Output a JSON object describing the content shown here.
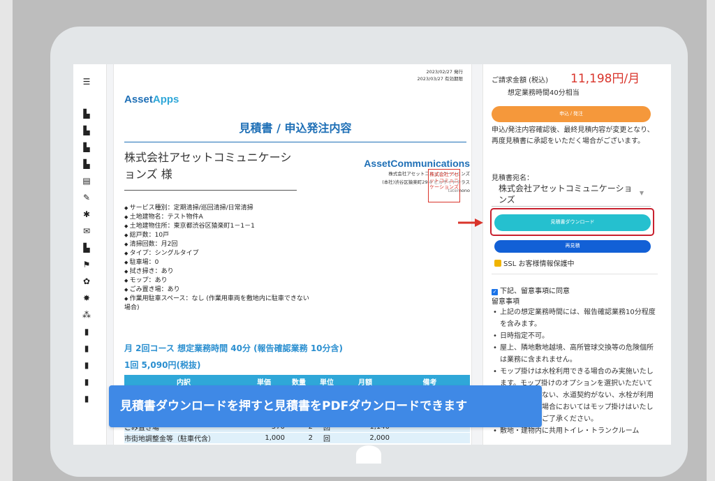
{
  "sidebar": {
    "icons": [
      "menu-icon",
      "building-icon",
      "building-icon",
      "building-icon",
      "building-icon",
      "calendar-icon",
      "wrench-icon",
      "runner-icon",
      "handshake-icon",
      "building-icon",
      "flag-icon",
      "gear-icon",
      "star-icon",
      "users-icon",
      "document-icon",
      "document-icon",
      "document-icon",
      "document-icon",
      "document-icon"
    ]
  },
  "document": {
    "issue_date": "2023/02/27 発行",
    "expiry_date": "2023/03/27 有効期限",
    "logo_a": "Asset",
    "logo_b": "Apps",
    "title": "見積書 / 申込発注内容",
    "client": "株式会社アセットコミュニケーションズ 様",
    "company_name": "AssetCommunications",
    "company_line1": "株式会社アセットコミュニケーションズ",
    "company_line2": "(本社)渋谷区猿楽町29-8 ヒルサイドテラス",
    "company_line3": "tatemono",
    "stamp": "株式会社アセットコミュニケーションズ",
    "items": [
      "サービス種別：定期清掃/巡回清掃/日常清掃",
      "土地建物名：テスト物件A",
      "土地建物住所：東京都渋谷区猿楽町1－1－1",
      "総戸数：10戸",
      "清掃回数：月2回",
      "タイプ：シングルタイプ",
      "駐車場：0",
      "拭き掃き：あり",
      "モップ：あり",
      "ごみ置き場：あり",
      "作業用駐車スペース：なし (作業用車両を敷地内に駐車できない場合)"
    ],
    "course": "月 2回コース 想定業務時間 40分 (報告確認業務 10分含)",
    "price": "1回 5,090円(税抜)",
    "table": {
      "headers": [
        "内訳",
        "単価",
        "数量",
        "単位",
        "月額",
        "備考"
      ],
      "rows": [
        [
          "ごみ置き場",
          "570",
          "2",
          "回",
          "1,140",
          ""
        ],
        [
          "市街地調整金等（駐車代含）",
          "1,000",
          "2",
          "回",
          "2,000",
          ""
        ]
      ]
    }
  },
  "summary": {
    "amount_label": "ご請求金額 (税込)",
    "amount": "11,198円/月",
    "hours": "想定業務時間40分相当",
    "order_button": "申込 / 発注",
    "note": "申込/発注内容確認後、最終見積内容が変更となり、再度見積書に承認をいただく場合がございます。",
    "dest_label": "見積書宛名：",
    "dest_value": "株式会社アセットコミュニケーションズ",
    "download_button": "見積書ダウンロード",
    "review_button": "再見積",
    "ssl_text": "SSL お客様情報保護中",
    "agree_text": "下記、留意事項に同意",
    "notes_title": "留意事項",
    "notes": [
      "上記の想定業務時間には、報告確認業務10分程度を含みます。",
      "日時指定不可。",
      "屋上、隣地敷地越境、高所管球交換等の危険個所は業務に含まれません。",
      "モップ掛けは水栓利用できる場合のみ実施いたします。モップ掛けのオプションを選択いただいても共用水栓がない、水道契約がない、水栓が利用できない等の場合においてはモップ掛けはいたしかねますのでご了承ください。",
      "敷地・建物内に共用トイレ・トランクルーム"
    ]
  },
  "banner": {
    "text": "見積書ダウンロードを押すと見積書をPDFダウンロードできます"
  },
  "colors": {
    "accent_red": "#d9342b",
    "order_orange": "#f5983b",
    "download_teal": "#25c0cf",
    "review_blue": "#1260d6",
    "banner_blue": "#3f89e6"
  }
}
